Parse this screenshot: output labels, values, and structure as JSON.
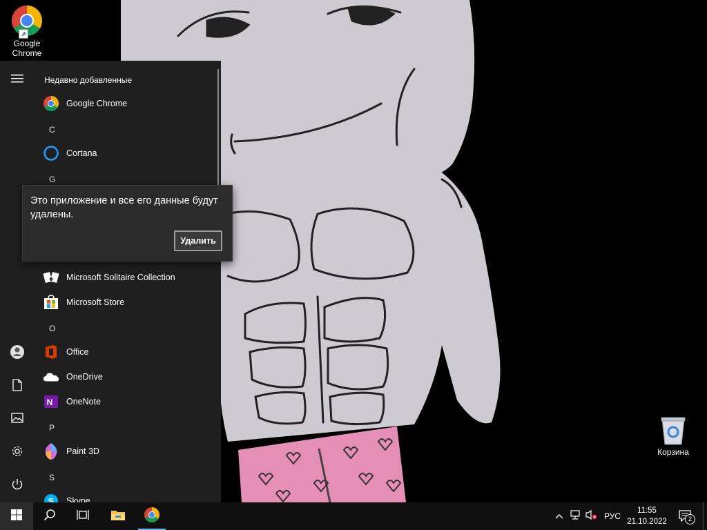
{
  "desktop": {
    "icons": [
      {
        "label": "Google Chrome",
        "icon": "chrome-icon"
      },
      {
        "label": "Корзина",
        "icon": "recycle-bin-icon"
      }
    ]
  },
  "start_menu": {
    "rail": [
      {
        "icon": "hamburger-menu-icon"
      },
      {
        "icon": "user-account-icon"
      },
      {
        "icon": "documents-icon"
      },
      {
        "icon": "pictures-icon"
      },
      {
        "icon": "settings-gear-icon"
      },
      {
        "icon": "power-icon"
      }
    ],
    "recently_added_header": "Недавно добавленные",
    "apps": {
      "chrome": "Google Chrome",
      "cortana": "Cortana",
      "solitaire": "Microsoft Solitaire Collection",
      "store": "Microsoft Store",
      "office": "Office",
      "onedrive": "OneDrive",
      "onenote": "OneNote",
      "paint3d": "Paint 3D",
      "skype": "Skype"
    },
    "letters": {
      "c": "C",
      "g": "G",
      "o": "O",
      "p": "P",
      "s": "S"
    }
  },
  "uninstall_flyout": {
    "message": "Это приложение и все его данные будут удалены.",
    "button": "Удалить"
  },
  "taskbar": {
    "buttons": [
      {
        "icon": "windows-start-icon"
      },
      {
        "icon": "search-icon"
      },
      {
        "icon": "task-view-icon"
      },
      {
        "icon": "file-explorer-icon"
      },
      {
        "icon": "chrome-icon"
      }
    ],
    "tray": {
      "language": "РУС",
      "time": "11:55",
      "date": "21.10.2022",
      "notifications_count": "2"
    }
  },
  "colors": {
    "start_menu_bg": "#1f1f1f",
    "taskbar_bg": "#101010",
    "accent": "#6fb6ff",
    "heart_pink": "#e58fb6"
  }
}
